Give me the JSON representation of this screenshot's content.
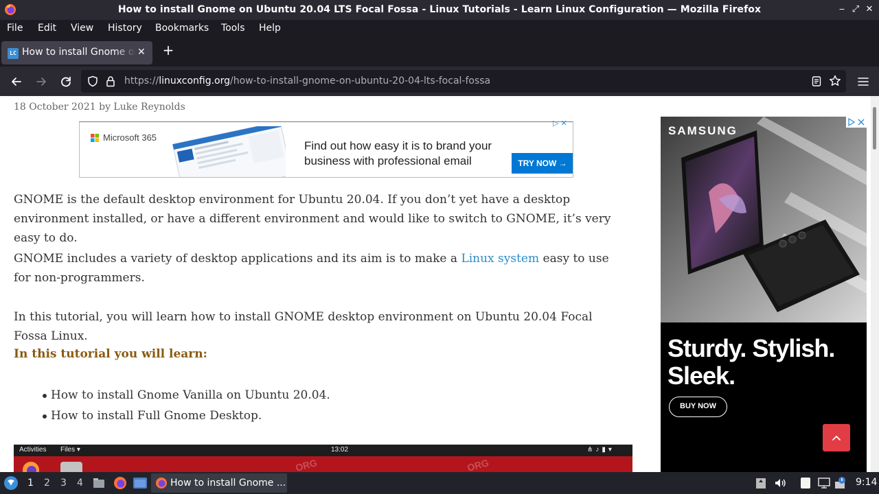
{
  "window": {
    "title": "How to install Gnome on Ubuntu 20.04 LTS Focal Fossa - Linux Tutorials - Learn Linux Configuration — Mozilla Firefox"
  },
  "menu": {
    "file": "File",
    "edit": "Edit",
    "view": "View",
    "history": "History",
    "bookmarks": "Bookmarks",
    "tools": "Tools",
    "help": "Help"
  },
  "tab": {
    "favicon": "LC",
    "title": "How to install Gnome on Ubuntu 20.04 LTS Focal Fossa"
  },
  "url": {
    "prefix": "https://",
    "domain": "linuxconfig.org",
    "path": "/how-to-install-gnome-on-ubuntu-20-04-lts-focal-fossa"
  },
  "article": {
    "byline": "18 October 2021 by Luke Reynolds",
    "p1": "GNOME is the default desktop environment for Ubuntu 20.04. If you don’t yet have a desktop environment installed, or have a different environment and would like to switch to GNOME, it’s very easy to do.",
    "p2_before": "GNOME includes a variety of desktop applications and its aim is to make a ",
    "p2_link": "Linux system",
    "p2_after": " easy to use for non-programmers.",
    "p3": "In this tutorial, you will learn how to install GNOME desktop environment on Ubuntu 20.04 Focal Fossa Linux.",
    "learn_heading": "In this tutorial you will learn:",
    "bullets": [
      "How to install Gnome Vanilla on Ubuntu 20.04.",
      "How to install Full Gnome Desktop."
    ]
  },
  "embedded_screenshot": {
    "activities": "Activities",
    "files": "Files ▾",
    "clock": "13:02"
  },
  "ad_microsoft": {
    "brand": "Microsoft 365",
    "headline": "Find out how easy it is to brand your business with professional email",
    "cta": "TRY NOW →",
    "choices": "▷ ✕"
  },
  "ad_samsung": {
    "brand": "SAMSUNG",
    "tagline": "Sturdy. Stylish. Sleek.",
    "cta": "BUY NOW"
  },
  "taskbar": {
    "workspaces": [
      "1",
      "2",
      "3",
      "4"
    ],
    "active_workspace": "1",
    "task_label": "How to install Gnome ...",
    "clock": "9:14"
  },
  "colors": {
    "firefox_dark": "#1c1b22",
    "toolbar": "#2b2a33",
    "link": "#2d8dc7",
    "heading_gold": "#8a5a0f",
    "back_to_top": "#e23c44"
  }
}
